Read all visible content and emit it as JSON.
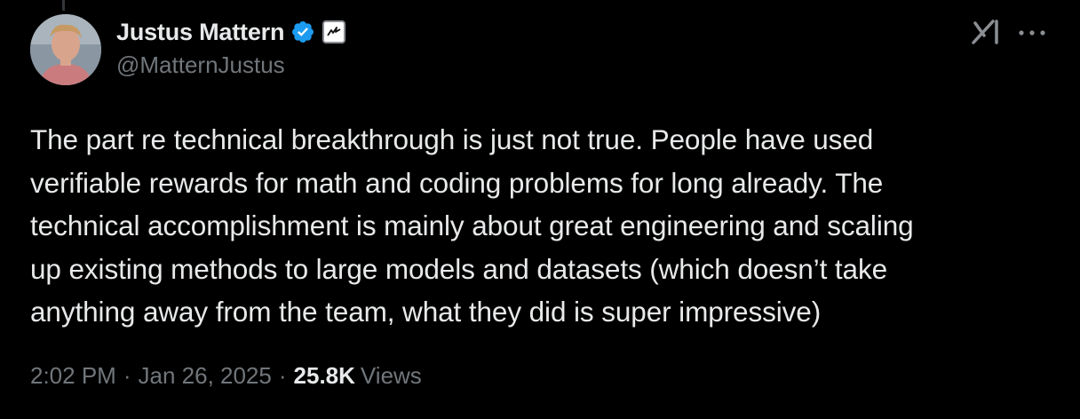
{
  "author": {
    "display_name": "Justus Mattern",
    "handle": "@MatternJustus",
    "verified_color": "#1d9bf0"
  },
  "tweet": {
    "lines": [
      "The part re technical breakthrough is just not true. People have used",
      "verifiable rewards for math and coding problems for long already. The",
      "technical accomplishment is mainly about great engineering and scaling",
      "up existing methods to large models and datasets (which doesn’t take",
      "anything away from the team, what they did is super impressive)"
    ]
  },
  "meta": {
    "time": "2:02 PM",
    "separator": "·",
    "date": "Jan 26, 2025",
    "views_count": "25.8K",
    "views_label": "Views"
  },
  "icons": {
    "verified": "verified-badge-icon",
    "affiliate": "affiliate-badge-icon",
    "grok": "grok-icon",
    "more": "more-icon"
  }
}
